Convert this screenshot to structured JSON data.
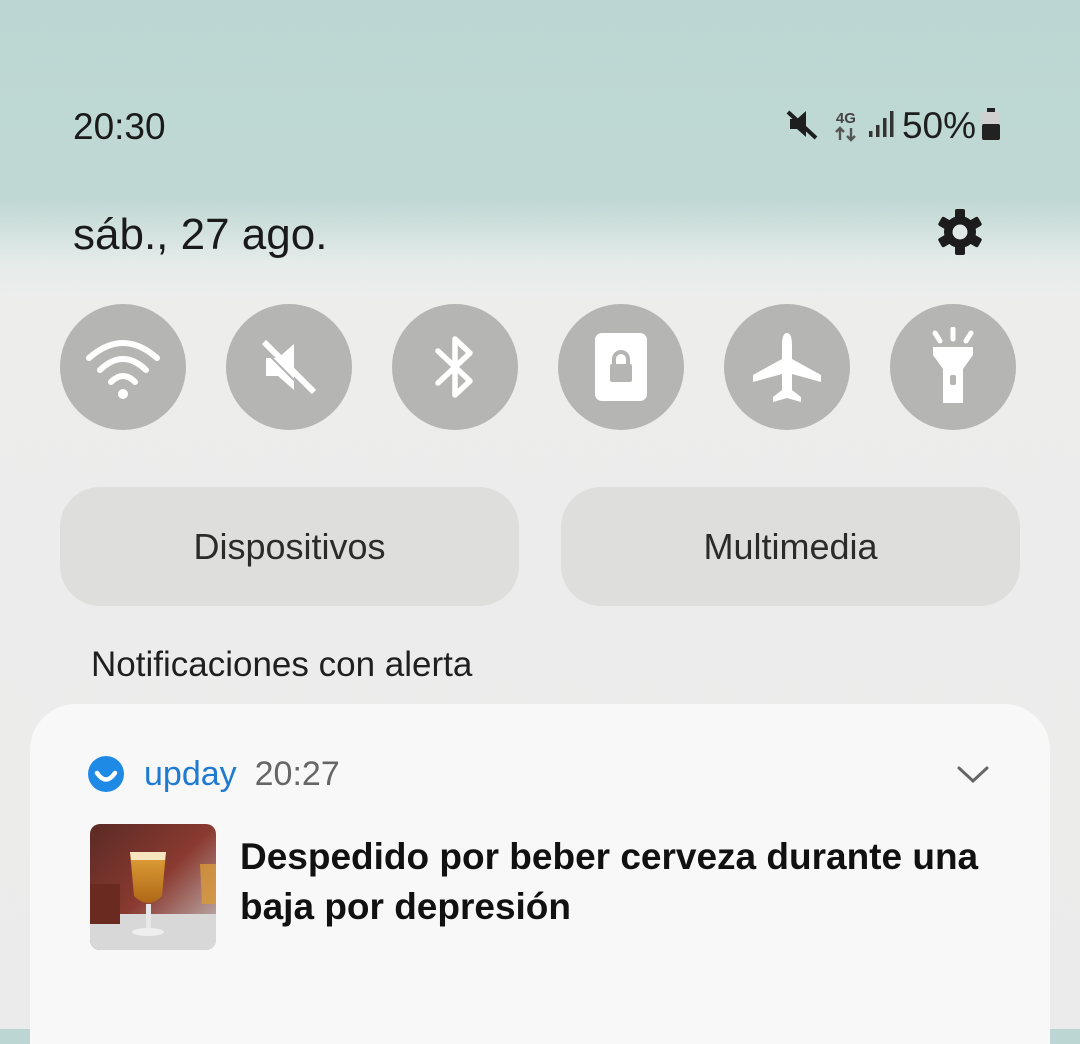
{
  "status_bar": {
    "time": "20:30",
    "icons": [
      "mute-icon",
      "4g-icon",
      "signal-icon",
      "battery-icon"
    ],
    "network_label": "4G",
    "battery_percent": "50%"
  },
  "header": {
    "date": "sáb., 27 ago.",
    "settings_icon": "gear-icon"
  },
  "quick_settings": [
    {
      "name": "wifi",
      "icon": "wifi-icon"
    },
    {
      "name": "sound",
      "icon": "mute-icon"
    },
    {
      "name": "bluetooth",
      "icon": "bluetooth-icon"
    },
    {
      "name": "rotation-lock",
      "icon": "portrait-lock-icon"
    },
    {
      "name": "airplane-mode",
      "icon": "airplane-icon"
    },
    {
      "name": "flashlight",
      "icon": "flashlight-icon"
    }
  ],
  "pills": {
    "devices": "Dispositivos",
    "media": "Multimedia"
  },
  "notifications": {
    "section_title": "Notificaciones con alerta",
    "items": [
      {
        "app": "upday",
        "time": "20:27",
        "headline": "Despedido por beber cerveza durante una baja por depresión",
        "thumbnail": "beer-glass-photo"
      }
    ]
  },
  "colors": {
    "accent": "#1f8ae6",
    "tile": "#b5b5b4",
    "pill": "#dededd"
  }
}
